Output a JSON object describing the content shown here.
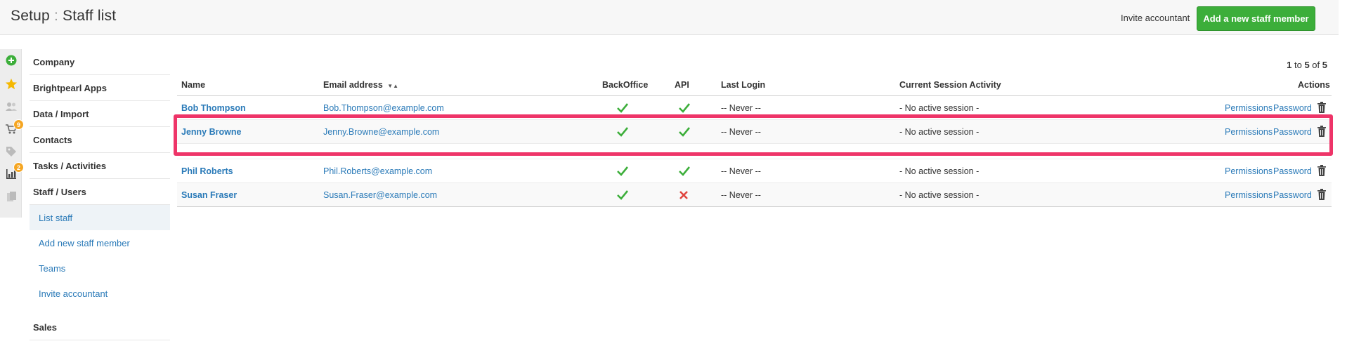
{
  "header": {
    "title_section": "Setup",
    "title_separator": ":",
    "title_page": "Staff list",
    "invite_label": "Invite accountant",
    "add_button_label": "Add a new staff member"
  },
  "rail": {
    "icons": [
      {
        "name": "add-icon",
        "color": "#3cae3a"
      },
      {
        "name": "star-icon",
        "color": "#f5b800"
      },
      {
        "name": "people-icon",
        "color": "#bbbbbb"
      },
      {
        "name": "cart-icon",
        "badge": "9"
      },
      {
        "name": "tag-icon",
        "color": "#bbbbbb"
      },
      {
        "name": "bar-chart-icon",
        "badge": "2"
      },
      {
        "name": "clipboard-icon",
        "color": "#bbbbbb"
      }
    ]
  },
  "nav": {
    "sections": [
      "Company",
      "Brightpearl Apps",
      "Data / Import",
      "Contacts",
      "Tasks / Activities",
      "Staff / Users"
    ],
    "staff_items": [
      "List staff",
      "Add new staff member",
      "Teams",
      "Invite accountant"
    ],
    "sales": "Sales"
  },
  "pager": {
    "prefix": "1",
    "mid": " to ",
    "to": "5",
    "of_text": " of ",
    "total": "5"
  },
  "table": {
    "headers": {
      "name": "Name",
      "email": "Email address",
      "backoffice": "BackOffice",
      "api": "API",
      "last_login": "Last Login",
      "session": "Current Session Activity",
      "actions": "Actions"
    },
    "rows": [
      {
        "name": "Bob Thompson",
        "email": "Bob.Thompson@example.com",
        "backoffice": true,
        "api": true,
        "last_login": "-- Never --",
        "session": "- No active session -",
        "permissions": "Permissions",
        "password": "Password"
      },
      {
        "name": "Jenny Browne",
        "email": "Jenny.Browne@example.com",
        "backoffice": true,
        "api": true,
        "last_login": "-- Never --",
        "session": "- No active session -",
        "permissions": "Permissions",
        "password": "Password"
      },
      {
        "name": "Phil Roberts",
        "email": "Phil.Roberts@example.com",
        "backoffice": true,
        "api": true,
        "last_login": "-- Never --",
        "session": "- No active session -",
        "permissions": "Permissions",
        "password": "Password"
      },
      {
        "name": "Susan Fraser",
        "email": "Susan.Fraser@example.com",
        "backoffice": true,
        "api": false,
        "last_login": "-- Never --",
        "session": "- No active session -",
        "permissions": "Permissions",
        "password": "Password"
      }
    ]
  },
  "colors": {
    "accent": "#2a7ab8",
    "button_green": "#3cae3a",
    "highlight": "#ee3468",
    "check": "#3cae3a",
    "cross": "#e0443e"
  }
}
